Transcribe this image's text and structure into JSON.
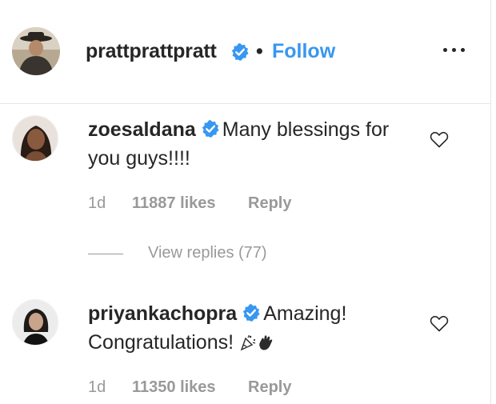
{
  "post_header": {
    "username": "prattprattpratt",
    "separator": "•",
    "follow_label": "Follow"
  },
  "comments": [
    {
      "username": "zoesaldana",
      "text_line1": "Many blessings for",
      "text_line2": "you guys!!!!",
      "age": "1d",
      "likes": "11887 likes",
      "reply_label": "Reply",
      "view_replies_label": "View replies (77)"
    },
    {
      "username": "priyankachopra",
      "text_line1": "Amazing!",
      "text_line2": "Congratulations!",
      "age": "1d",
      "likes": "11350 likes",
      "reply_label": "Reply"
    }
  ],
  "icons": {
    "verified": "verified-badge-icon",
    "more": "more-options-icon",
    "heart": "heart-outline-icon",
    "emoji": [
      "confetti-icon",
      "waving-hand-icon"
    ]
  },
  "colors": {
    "text": "#262626",
    "muted": "#999999",
    "link": "#3897f0",
    "verified": "#3897f0"
  }
}
